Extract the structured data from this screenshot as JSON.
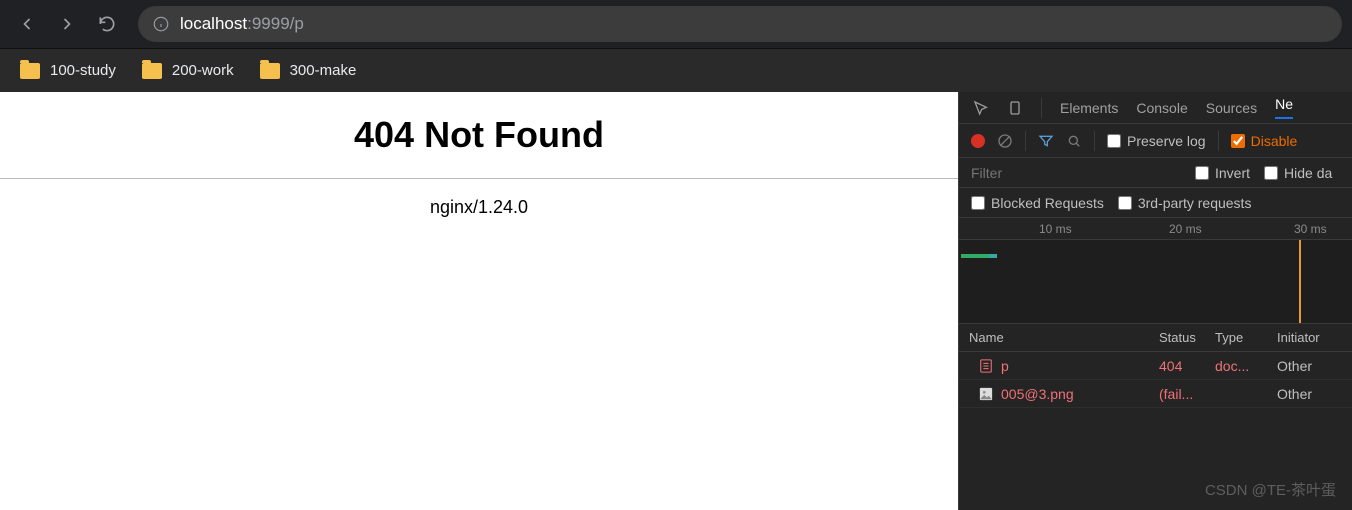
{
  "nav": {
    "url_host": "localhost",
    "url_port": ":9999",
    "url_path": "/p"
  },
  "bookmarks": [
    {
      "label": "100-study"
    },
    {
      "label": "200-work"
    },
    {
      "label": "300-make"
    }
  ],
  "page": {
    "heading": "404 Not Found",
    "server": "nginx/1.24.0"
  },
  "devtools": {
    "tabs": {
      "elements": "Elements",
      "console": "Console",
      "sources": "Sources",
      "network": "Ne"
    },
    "toolbar": {
      "preserve_log": "Preserve log",
      "disable_cache": "Disable"
    },
    "filter": {
      "placeholder": "Filter",
      "invert": "Invert",
      "hide_data": "Hide da"
    },
    "filter2": {
      "blocked": "Blocked Requests",
      "thirdparty": "3rd-party requests"
    },
    "timeline": {
      "t10": "10 ms",
      "t20": "20 ms",
      "t30": "30 ms"
    },
    "columns": {
      "name": "Name",
      "status": "Status",
      "type": "Type",
      "initiator": "Initiator"
    },
    "rows": [
      {
        "name": "p",
        "status": "404",
        "type": "doc...",
        "initiator": "Other",
        "error": true,
        "icon": "doc"
      },
      {
        "name": "005@3.png",
        "status": "(fail...",
        "type": "",
        "initiator": "Other",
        "error": true,
        "icon": "img"
      }
    ]
  },
  "watermark": "CSDN @TE-茶叶蛋"
}
